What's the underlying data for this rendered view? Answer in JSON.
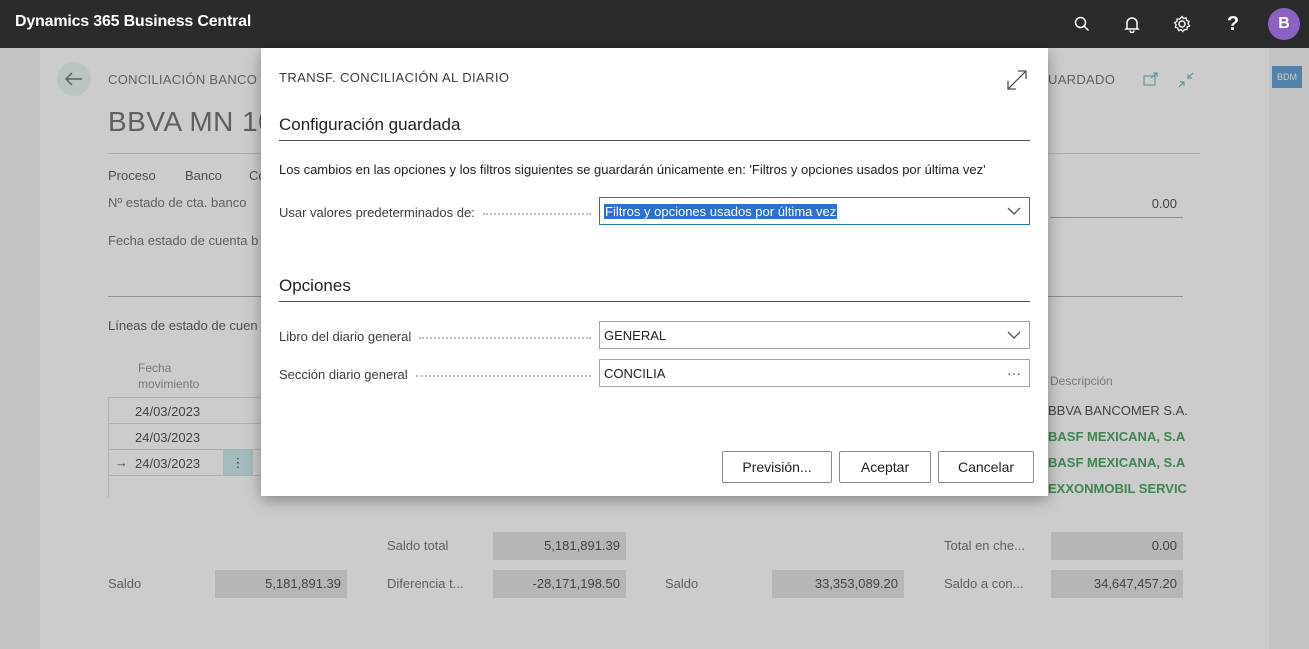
{
  "app": {
    "title": "Dynamics 365 Business Central",
    "avatar_initial": "B"
  },
  "topbar_icons": [
    "search-icon",
    "bell-icon",
    "gear-icon",
    "help-icon"
  ],
  "background_page": {
    "breadcrumb": "CONCILIACIÓN BANCO",
    "saved_indicator": "UARDADO",
    "title": "BBVA MN 10",
    "side_button": "BDM",
    "actions": [
      "Proceso",
      "Banco",
      "Co"
    ],
    "fields": {
      "statement_no_label": "Nº estado de cta. banco",
      "statement_date_label": "Fecha estado de cuenta b",
      "statement_value": "0.00"
    },
    "lines_title": "Líneas de estado de cuen",
    "grid": {
      "header_date": [
        "Fecha",
        "movimiento"
      ],
      "header_desc": "Descripción",
      "rows": [
        {
          "date": "24/03/2023",
          "desc": "BBVA BANCOMER S.A.",
          "green": false
        },
        {
          "date": "24/03/2023",
          "desc": "BASF MEXICANA, S.A",
          "green": true
        },
        {
          "date": "24/03/2023",
          "desc": "BASF MEXICANA, S.A",
          "green": true,
          "current": true
        },
        {
          "date": "",
          "desc": "EXXONMOBIL SERVIC",
          "green": true
        }
      ]
    },
    "totals": {
      "saldo_total_label": "Saldo total",
      "saldo_total": "5,181,891.39",
      "saldo_label": "Saldo",
      "saldo": "5,181,891.39",
      "diferencia_label": "Diferencia t...",
      "diferencia": "-28,171,198.50",
      "saldo2_label": "Saldo",
      "saldo2": "33,353,089.20",
      "total_cheques_label": "Total en che...",
      "total_cheques": "0.00",
      "saldo_conc_label": "Saldo a con...",
      "saldo_conc": "34,647,457.20"
    }
  },
  "dialog": {
    "caption": "TRANSF. CONCILIACIÓN AL DIARIO",
    "saved_section_title": "Configuración guardada",
    "info_text": "Los cambios en las opciones y los filtros siguientes se guardarán únicamente en: 'Filtros y opciones usados por última vez'",
    "defaults_label": "Usar valores predeterminados de:",
    "defaults_value": "Filtros y opciones usados por última vez",
    "options_section_title": "Opciones",
    "journal_template_label": "Libro del diario general",
    "journal_template_value": "GENERAL",
    "journal_batch_label": "Sección diario general",
    "journal_batch_value": "CONCILIA",
    "buttons": {
      "preview": "Previsión...",
      "ok": "Aceptar",
      "cancel": "Cancelar"
    }
  }
}
